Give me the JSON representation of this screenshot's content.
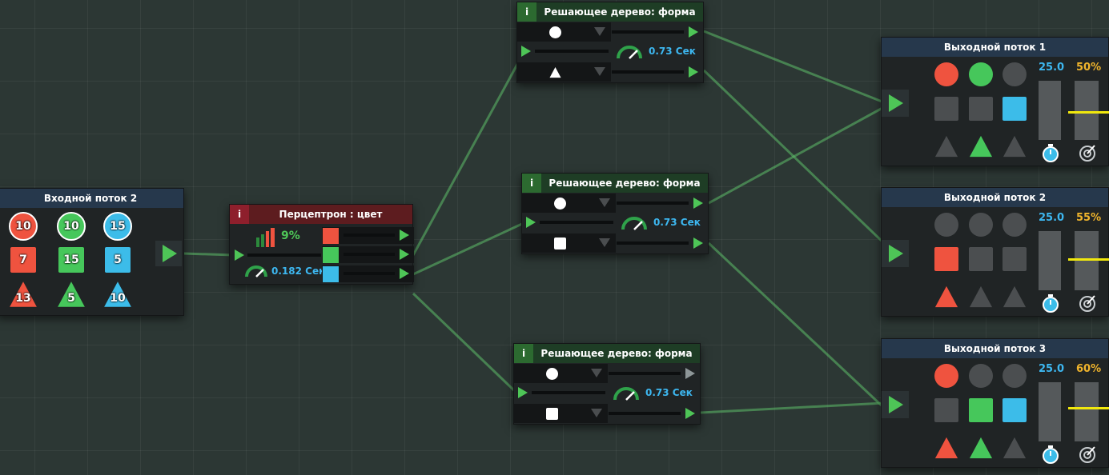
{
  "colors": {
    "red": "#ef533f",
    "green": "#46c75b",
    "blue": "#3cbce9",
    "gray": "#4b4e50",
    "wire": "#5fbf6a",
    "accent_speed": "#3db7f0",
    "accent_pct": "#f0b42c",
    "accent_yellow": "#f1e80d"
  },
  "input_node": {
    "title": "Входной поток 2",
    "items": [
      {
        "shape": "circle",
        "color": "red",
        "count": "10"
      },
      {
        "shape": "circle",
        "color": "green",
        "count": "10"
      },
      {
        "shape": "circle",
        "color": "blue",
        "count": "15"
      },
      {
        "shape": "square",
        "color": "red",
        "count": "7"
      },
      {
        "shape": "square",
        "color": "green",
        "count": "15"
      },
      {
        "shape": "square",
        "color": "blue",
        "count": "5"
      },
      {
        "shape": "triangle",
        "color": "red",
        "count": "13"
      },
      {
        "shape": "triangle",
        "color": "green",
        "count": "5"
      },
      {
        "shape": "triangle",
        "color": "blue",
        "count": "10"
      }
    ]
  },
  "perceptron": {
    "info": "i",
    "title": "Перцептрон : цвет",
    "accuracy": "9%",
    "speed": "0.182 Сек",
    "outputs": [
      "red",
      "green",
      "blue"
    ]
  },
  "trees": [
    {
      "info": "i",
      "title": "Решающее дерево: форма",
      "speed": "0.73 Сек",
      "top_shape": "circle",
      "bottom_shape": "triangle",
      "top_port_active": true
    },
    {
      "info": "i",
      "title": "Решающее дерево: форма",
      "speed": "0.73 Сек",
      "top_shape": "circle",
      "bottom_shape": "square",
      "top_port_active": true
    },
    {
      "info": "i",
      "title": "Решающее дерево: форма",
      "speed": "0.73 Сек",
      "top_shape": "circle",
      "bottom_shape": "square",
      "top_port_active": false
    }
  ],
  "outputs": [
    {
      "title": "Выходной поток 1",
      "speed": "25.0",
      "percent": "50%",
      "level": 0.5,
      "grid": [
        [
          "circle",
          "red"
        ],
        [
          "circle",
          "green"
        ],
        [
          "circle",
          "gray"
        ],
        [
          "square",
          "gray"
        ],
        [
          "square",
          "gray"
        ],
        [
          "square",
          "blue"
        ],
        [
          "triangle",
          "gray"
        ],
        [
          "triangle",
          "green"
        ],
        [
          "triangle",
          "gray"
        ]
      ]
    },
    {
      "title": "Выходной поток 2",
      "speed": "25.0",
      "percent": "55%",
      "level": 0.55,
      "grid": [
        [
          "circle",
          "gray"
        ],
        [
          "circle",
          "gray"
        ],
        [
          "circle",
          "gray"
        ],
        [
          "square",
          "red"
        ],
        [
          "square",
          "gray"
        ],
        [
          "square",
          "gray"
        ],
        [
          "triangle",
          "red"
        ],
        [
          "triangle",
          "gray"
        ],
        [
          "triangle",
          "gray"
        ]
      ]
    },
    {
      "title": "Выходной поток 3",
      "speed": "25.0",
      "percent": "60%",
      "level": 0.6,
      "grid": [
        [
          "circle",
          "red"
        ],
        [
          "circle",
          "gray"
        ],
        [
          "circle",
          "gray"
        ],
        [
          "square",
          "gray"
        ],
        [
          "square",
          "green"
        ],
        [
          "square",
          "blue"
        ],
        [
          "triangle",
          "red"
        ],
        [
          "triangle",
          "green"
        ],
        [
          "triangle",
          "gray"
        ]
      ]
    }
  ]
}
